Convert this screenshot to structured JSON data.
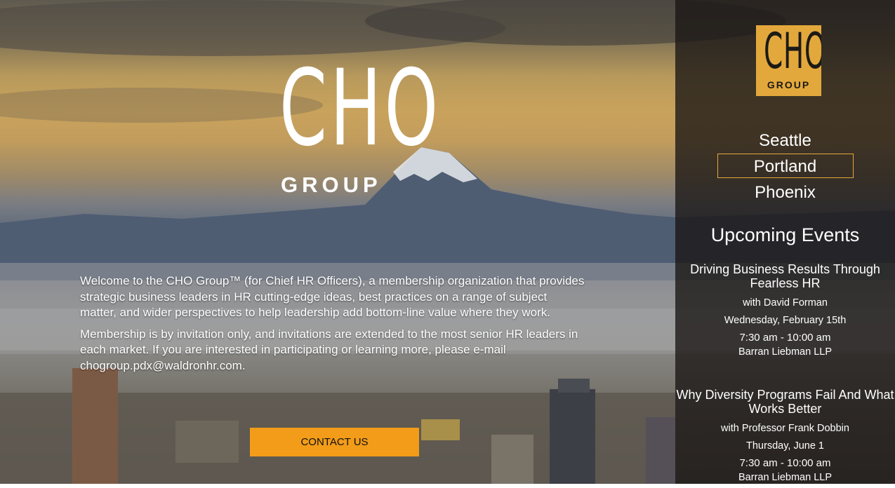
{
  "hero": {
    "logo_letters": "CHO",
    "logo_sub": "GROUP",
    "paragraphs": [
      "Welcome to the CHO Group™ (for Chief HR Officers), a membership organization that provides strategic business leaders in HR cutting-edge ideas, best practices on a range of subject matter, and wider perspectives to help leadership add bottom-line value where they work.",
      "Membership is by invitation only, and invitations are extended to the most senior HR leaders in each market. If you are interested in participating or learning more, please e-mail chogroup.pdx@waldronhr.com."
    ],
    "contact_label": "CONTACT US"
  },
  "sidebar": {
    "logo_letters": "CHO",
    "logo_sub": "GROUP",
    "cities": [
      {
        "label": "Seattle",
        "active": false
      },
      {
        "label": "Portland",
        "active": true
      },
      {
        "label": "Phoenix",
        "active": false
      }
    ],
    "events_heading": "Upcoming Events",
    "events": [
      {
        "title": "Driving Business Results Through Fearless HR",
        "speaker": "with David Forman",
        "date": "Wednesday, February 15th",
        "time": "7:30 am - 10:00 am",
        "venue": "Barran Liebman LLP"
      },
      {
        "title": "Why Diversity Programs Fail And What Works Better",
        "speaker": "with Professor Frank Dobbin",
        "date": "Thursday, June 1",
        "time": "7:30 am - 10:00 am",
        "venue": "Barran Liebman LLP"
      }
    ]
  },
  "colors": {
    "accent": "#f29c19",
    "logo_bg": "#e3a83c"
  }
}
